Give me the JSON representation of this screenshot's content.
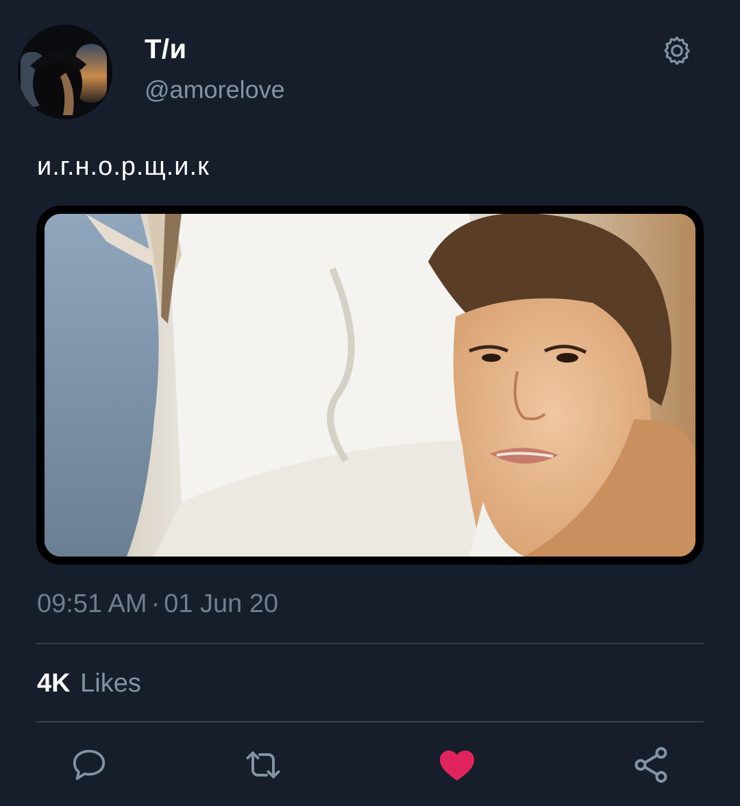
{
  "profile": {
    "display_name": "Т/и",
    "handle": "@amorelove"
  },
  "tweet": {
    "text": "и.г.н.о.р.щ.и.к",
    "time": "09:51 AM",
    "separator": "·",
    "date": "01 Jun 20"
  },
  "stats": {
    "likes_count": "4K",
    "likes_label": "Likes"
  },
  "icons": {
    "settings": "gear-icon",
    "reply": "comment-icon",
    "retweet": "retweet-icon",
    "like": "heart-icon",
    "share": "share-icon"
  },
  "colors": {
    "background": "#161e2b",
    "text_primary": "#ffffff",
    "text_secondary": "#8393a4",
    "icon": "#8393a4",
    "like_active": "#e0245e",
    "divider": "#36404d"
  }
}
